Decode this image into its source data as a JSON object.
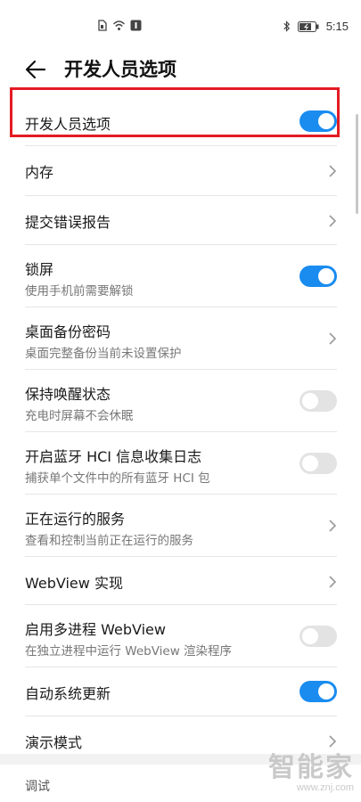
{
  "status_bar": {
    "time": "5:15"
  },
  "header": {
    "title": "开发人员选项"
  },
  "rows": [
    {
      "title": "开发人员选项",
      "subtitle": "",
      "control": "toggle",
      "state": true
    },
    {
      "title": "内存",
      "subtitle": "",
      "control": "chevron"
    },
    {
      "title": "提交错误报告",
      "subtitle": "",
      "control": "chevron"
    },
    {
      "title": "锁屏",
      "subtitle": "使用手机前需要解锁",
      "control": "toggle",
      "state": true
    },
    {
      "title": "桌面备份密码",
      "subtitle": "桌面完整备份当前未设置保护",
      "control": "chevron"
    },
    {
      "title": "保持唤醒状态",
      "subtitle": "充电时屏幕不会休眠",
      "control": "toggle",
      "state": false
    },
    {
      "title": "开启蓝牙 HCI 信息收集日志",
      "subtitle": "捕获单个文件中的所有蓝牙 HCI 包",
      "control": "toggle",
      "state": false
    },
    {
      "title": "正在运行的服务",
      "subtitle": "查看和控制当前正在运行的服务",
      "control": "chevron"
    },
    {
      "title": "WebView 实现",
      "subtitle": "",
      "control": "chevron"
    },
    {
      "title": "启用多进程 WebView",
      "subtitle": "在独立进程中运行 WebView 渲染程序",
      "control": "toggle",
      "state": false
    },
    {
      "title": "自动系统更新",
      "subtitle": "",
      "control": "toggle",
      "state": true
    },
    {
      "title": "演示模式",
      "subtitle": "",
      "control": "chevron"
    }
  ],
  "section": {
    "label": "调试"
  },
  "watermark": {
    "main": "智能家",
    "sub": "www.znj.com"
  },
  "colors": {
    "toggle_on": "#1a8cf0",
    "toggle_off": "#e3e3e3",
    "highlight": "#e31b23"
  }
}
